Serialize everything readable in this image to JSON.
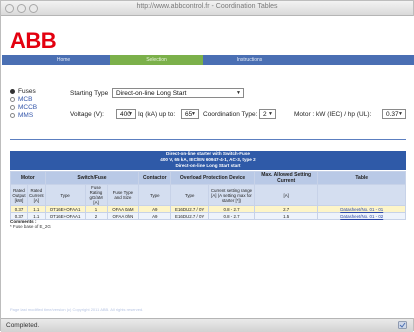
{
  "window": {
    "title": "http://www.abbcontrol.fr - Coordination Tables"
  },
  "brand": {
    "logo_text": "ABB",
    "logo_color": "#e3000f"
  },
  "topnav": [
    "Home",
    "Selection",
    "Instructions"
  ],
  "device_types": [
    {
      "label": "Fuses",
      "selected": true
    },
    {
      "label": "MCB",
      "selected": false
    },
    {
      "label": "MCCB",
      "selected": false
    },
    {
      "label": "MMS",
      "selected": false
    }
  ],
  "form": {
    "starting_type_label": "Starting Type",
    "starting_type_value": "Direct-on-line Long Start",
    "voltage_label": "Voltage (V):",
    "voltage_value": "400",
    "iq_label": "Iq (kA) up to:",
    "iq_value": "65",
    "coordination_label": "Coordination Type:",
    "coordination_value": "2",
    "motor_label": "Motor : kW (IEC) / hp (UL):",
    "motor_value": "0.37"
  },
  "table": {
    "title_lines": [
      "Direct-on-line starter with Switch-Fuse",
      "400 V, 65 kA, IEC/EN 60947-4-1, AC-3, type 2",
      "Direct-on-line Long Start start"
    ],
    "group_headers": [
      "Motor",
      "Switch/Fuse",
      "Contactor",
      "Overload Protection Device",
      "Max. Allowed Setting Current",
      "Table"
    ],
    "sub_headers": [
      "Rated Output [kW]",
      "Rated Current [A]",
      "Type",
      "Fuse Rating gG/aM [A]",
      "Fuse Type and Size",
      "Type",
      "Type",
      "Current setting range [A] (A setting max for starter [*])",
      "[A]",
      ""
    ],
    "rows": [
      [
        "0.37",
        "1.1",
        "OT16E+OFAA1",
        "1",
        "OFAA 0aM",
        "A9",
        "E16DU2.7 / 0Y",
        "0.8 - 2.7",
        "2.7",
        "Datasheet/No. 01 - 01"
      ],
      [
        "0.37",
        "1.1",
        "OT16E+OFAA1",
        "2",
        "OFAA 0hN",
        "A9",
        "E16DU2.7 / 0Y",
        "0.8 - 2.7",
        "1.5",
        "Datasheet/No. 01 - 02"
      ]
    ],
    "comments_label": "Comments :",
    "footnote": "* Fuse base of E_2G"
  },
  "footer": "Page last modified time/version (c) Copyright 2011 ABB. All rights reserved.",
  "status": {
    "text": "Completed."
  }
}
